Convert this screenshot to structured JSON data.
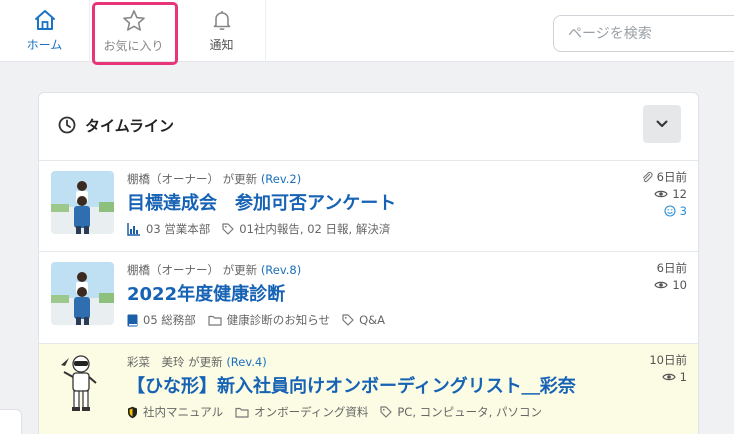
{
  "nav": {
    "home": {
      "label": "ホーム",
      "icon": "home-icon",
      "color": "#1a73c5"
    },
    "favorites": {
      "label": "お気に入り",
      "icon": "star-icon"
    },
    "notifications": {
      "label": "通知",
      "icon": "bell-icon"
    }
  },
  "search": {
    "placeholder": "ページを検索"
  },
  "timeline": {
    "title": "タイムライン",
    "entries": [
      {
        "author": "棚橋（オーナー）",
        "action": "が更新",
        "rev": "(Rev.2)",
        "title": "目標達成会　参加可否アンケート",
        "category": "03 営業本部",
        "category_icon": "chart-icon",
        "tags": "01社内報告, 02 日報, 解決済",
        "time": "6日前",
        "views": "12",
        "reactions": "3",
        "has_attachment": true
      },
      {
        "author": "棚橋（オーナー）",
        "action": "が更新",
        "rev": "(Rev.8)",
        "title": "2022年度健康診断",
        "category": "05 総務部",
        "category_icon": "book-icon",
        "folder": "健康診断のお知らせ",
        "tags": "Q&A",
        "time": "6日前",
        "views": "10"
      },
      {
        "author": "彩菜　美玲",
        "action": "が更新",
        "rev": "(Rev.4)",
        "title": "【ひな形】新入社員向けオンボーディングリスト＿彩奈",
        "category": "社内マニュアル",
        "category_icon": "shield-icon",
        "folder": "オンボーディング資料",
        "tags": "PC, コンピュータ, パソコン",
        "time": "10日前",
        "views": "1",
        "highlight_color": "#fbfce3"
      }
    ]
  },
  "colors": {
    "accent": "#1662b5",
    "highlight": "#e8357a"
  }
}
